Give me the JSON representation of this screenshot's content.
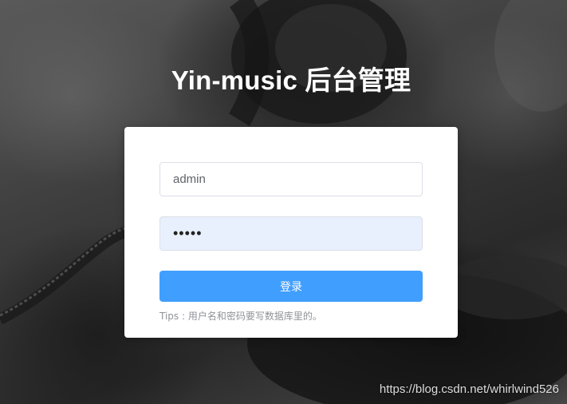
{
  "header": {
    "title": "Yin-music 后台管理"
  },
  "login_form": {
    "username_value": "admin",
    "password_value": "•••••",
    "submit_label": "登录",
    "tips": "Tips : 用户名和密码要写数据库里的。"
  },
  "watermark": {
    "text": "https://blog.csdn.net/whirlwind526"
  },
  "colors": {
    "primary_button": "#409eff",
    "autofill_background": "#e8f0fe",
    "card_background": "#ffffff"
  }
}
